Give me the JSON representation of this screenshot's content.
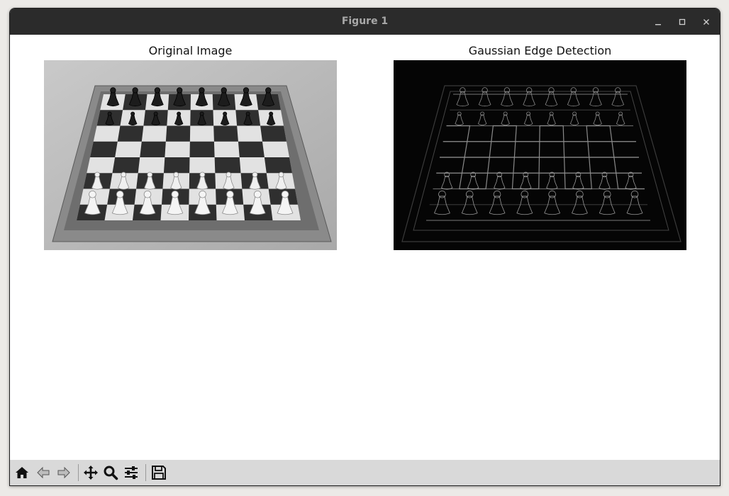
{
  "window": {
    "title": "Figure 1"
  },
  "window_controls": [
    {
      "name": "minimize",
      "icon": "minimize-icon"
    },
    {
      "name": "maximize",
      "icon": "maximize-icon"
    },
    {
      "name": "close",
      "icon": "close-icon"
    }
  ],
  "axes": [
    {
      "title": "Original Image",
      "content": "grayscale chessboard photograph"
    },
    {
      "title": "Gaussian Edge Detection",
      "content": "edge map of chessboard"
    }
  ],
  "toolbar": {
    "buttons": [
      {
        "name": "home",
        "icon": "home-icon"
      },
      {
        "name": "back",
        "icon": "back-arrow-icon"
      },
      {
        "name": "forward",
        "icon": "forward-arrow-icon"
      },
      {
        "name": "pan",
        "icon": "move-icon"
      },
      {
        "name": "zoom",
        "icon": "magnifier-icon"
      },
      {
        "name": "configure-subplots",
        "icon": "sliders-icon"
      },
      {
        "name": "save",
        "icon": "floppy-disk-icon"
      }
    ]
  },
  "colors": {
    "titlebar": "#2b2b2b",
    "toolbar": "#d9d9d9",
    "canvas": "#ffffff"
  }
}
